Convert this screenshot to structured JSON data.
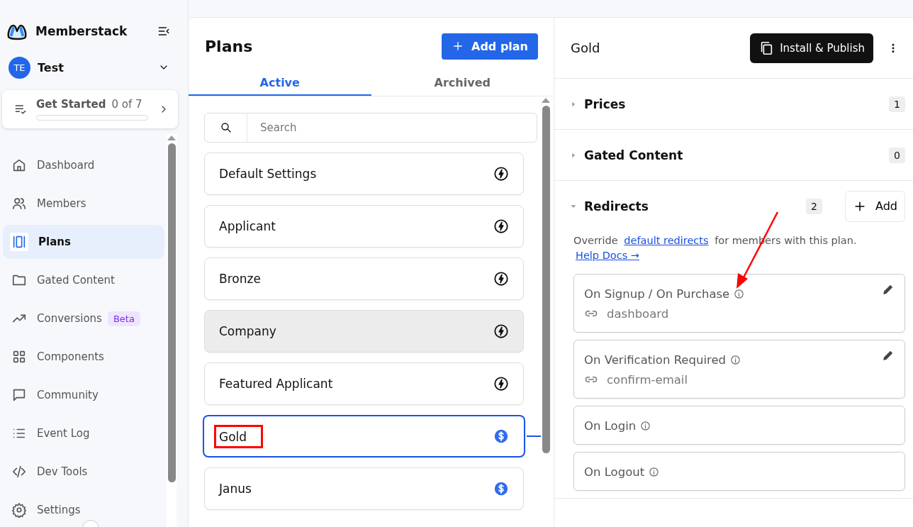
{
  "sidebar": {
    "brand": "Memberstack",
    "workspace": {
      "initials": "TE",
      "name": "Test"
    },
    "get_started": {
      "label": "Get Started",
      "progress": "0 of 7",
      "level": 0
    },
    "items": [
      {
        "label": "Dashboard",
        "selected": false
      },
      {
        "label": "Members",
        "selected": false
      },
      {
        "label": "Plans",
        "selected": true
      },
      {
        "label": "Gated Content",
        "selected": false
      },
      {
        "label": "Conversions",
        "selected": false,
        "badge": "Beta"
      },
      {
        "label": "Components",
        "selected": false
      },
      {
        "label": "Community",
        "selected": false
      },
      {
        "label": "Event Log",
        "selected": false
      },
      {
        "label": "Dev Tools",
        "selected": false
      },
      {
        "label": "Settings",
        "selected": false
      }
    ]
  },
  "plans_panel": {
    "title": "Plans",
    "add_button": "Add plan",
    "tabs": [
      {
        "label": "Active",
        "selected": true
      },
      {
        "label": "Archived",
        "selected": false
      }
    ],
    "search": {
      "placeholder": "Search"
    },
    "plans": [
      {
        "name": "Default Settings",
        "kind": "free",
        "selected": false,
        "hovered": false,
        "annotated": false
      },
      {
        "name": "Applicant",
        "kind": "free",
        "selected": false,
        "hovered": false,
        "annotated": false
      },
      {
        "name": "Bronze",
        "kind": "free",
        "selected": false,
        "hovered": false,
        "annotated": false
      },
      {
        "name": "Company",
        "kind": "free",
        "selected": false,
        "hovered": true,
        "annotated": false
      },
      {
        "name": "Featured Applicant",
        "kind": "free",
        "selected": false,
        "hovered": false,
        "annotated": false
      },
      {
        "name": "Gold",
        "kind": "paid",
        "selected": true,
        "hovered": false,
        "annotated": true
      },
      {
        "name": "Janus",
        "kind": "paid",
        "selected": false,
        "hovered": false,
        "annotated": false
      }
    ]
  },
  "detail": {
    "title": "Gold",
    "publish_button": "Install & Publish",
    "sections": [
      {
        "title": "Prices",
        "count": "1",
        "expanded": false
      },
      {
        "title": "Gated Content",
        "count": "0",
        "expanded": false
      },
      {
        "title": "Redirects",
        "count": "2",
        "expanded": true,
        "add_button": "Add"
      }
    ],
    "redirects_intro": {
      "before": "Override",
      "link": "default redirects",
      "after": "for members with this plan.",
      "help_link": "Help Docs →"
    },
    "redirects": [
      {
        "label": "On Signup / On Purchase",
        "value": "dashboard",
        "editable": true
      },
      {
        "label": "On Verification Required",
        "value": "confirm-email",
        "editable": true
      },
      {
        "label": "On Login",
        "editable": false
      },
      {
        "label": "On Logout",
        "editable": false
      }
    ],
    "annotation_arrow": true
  }
}
